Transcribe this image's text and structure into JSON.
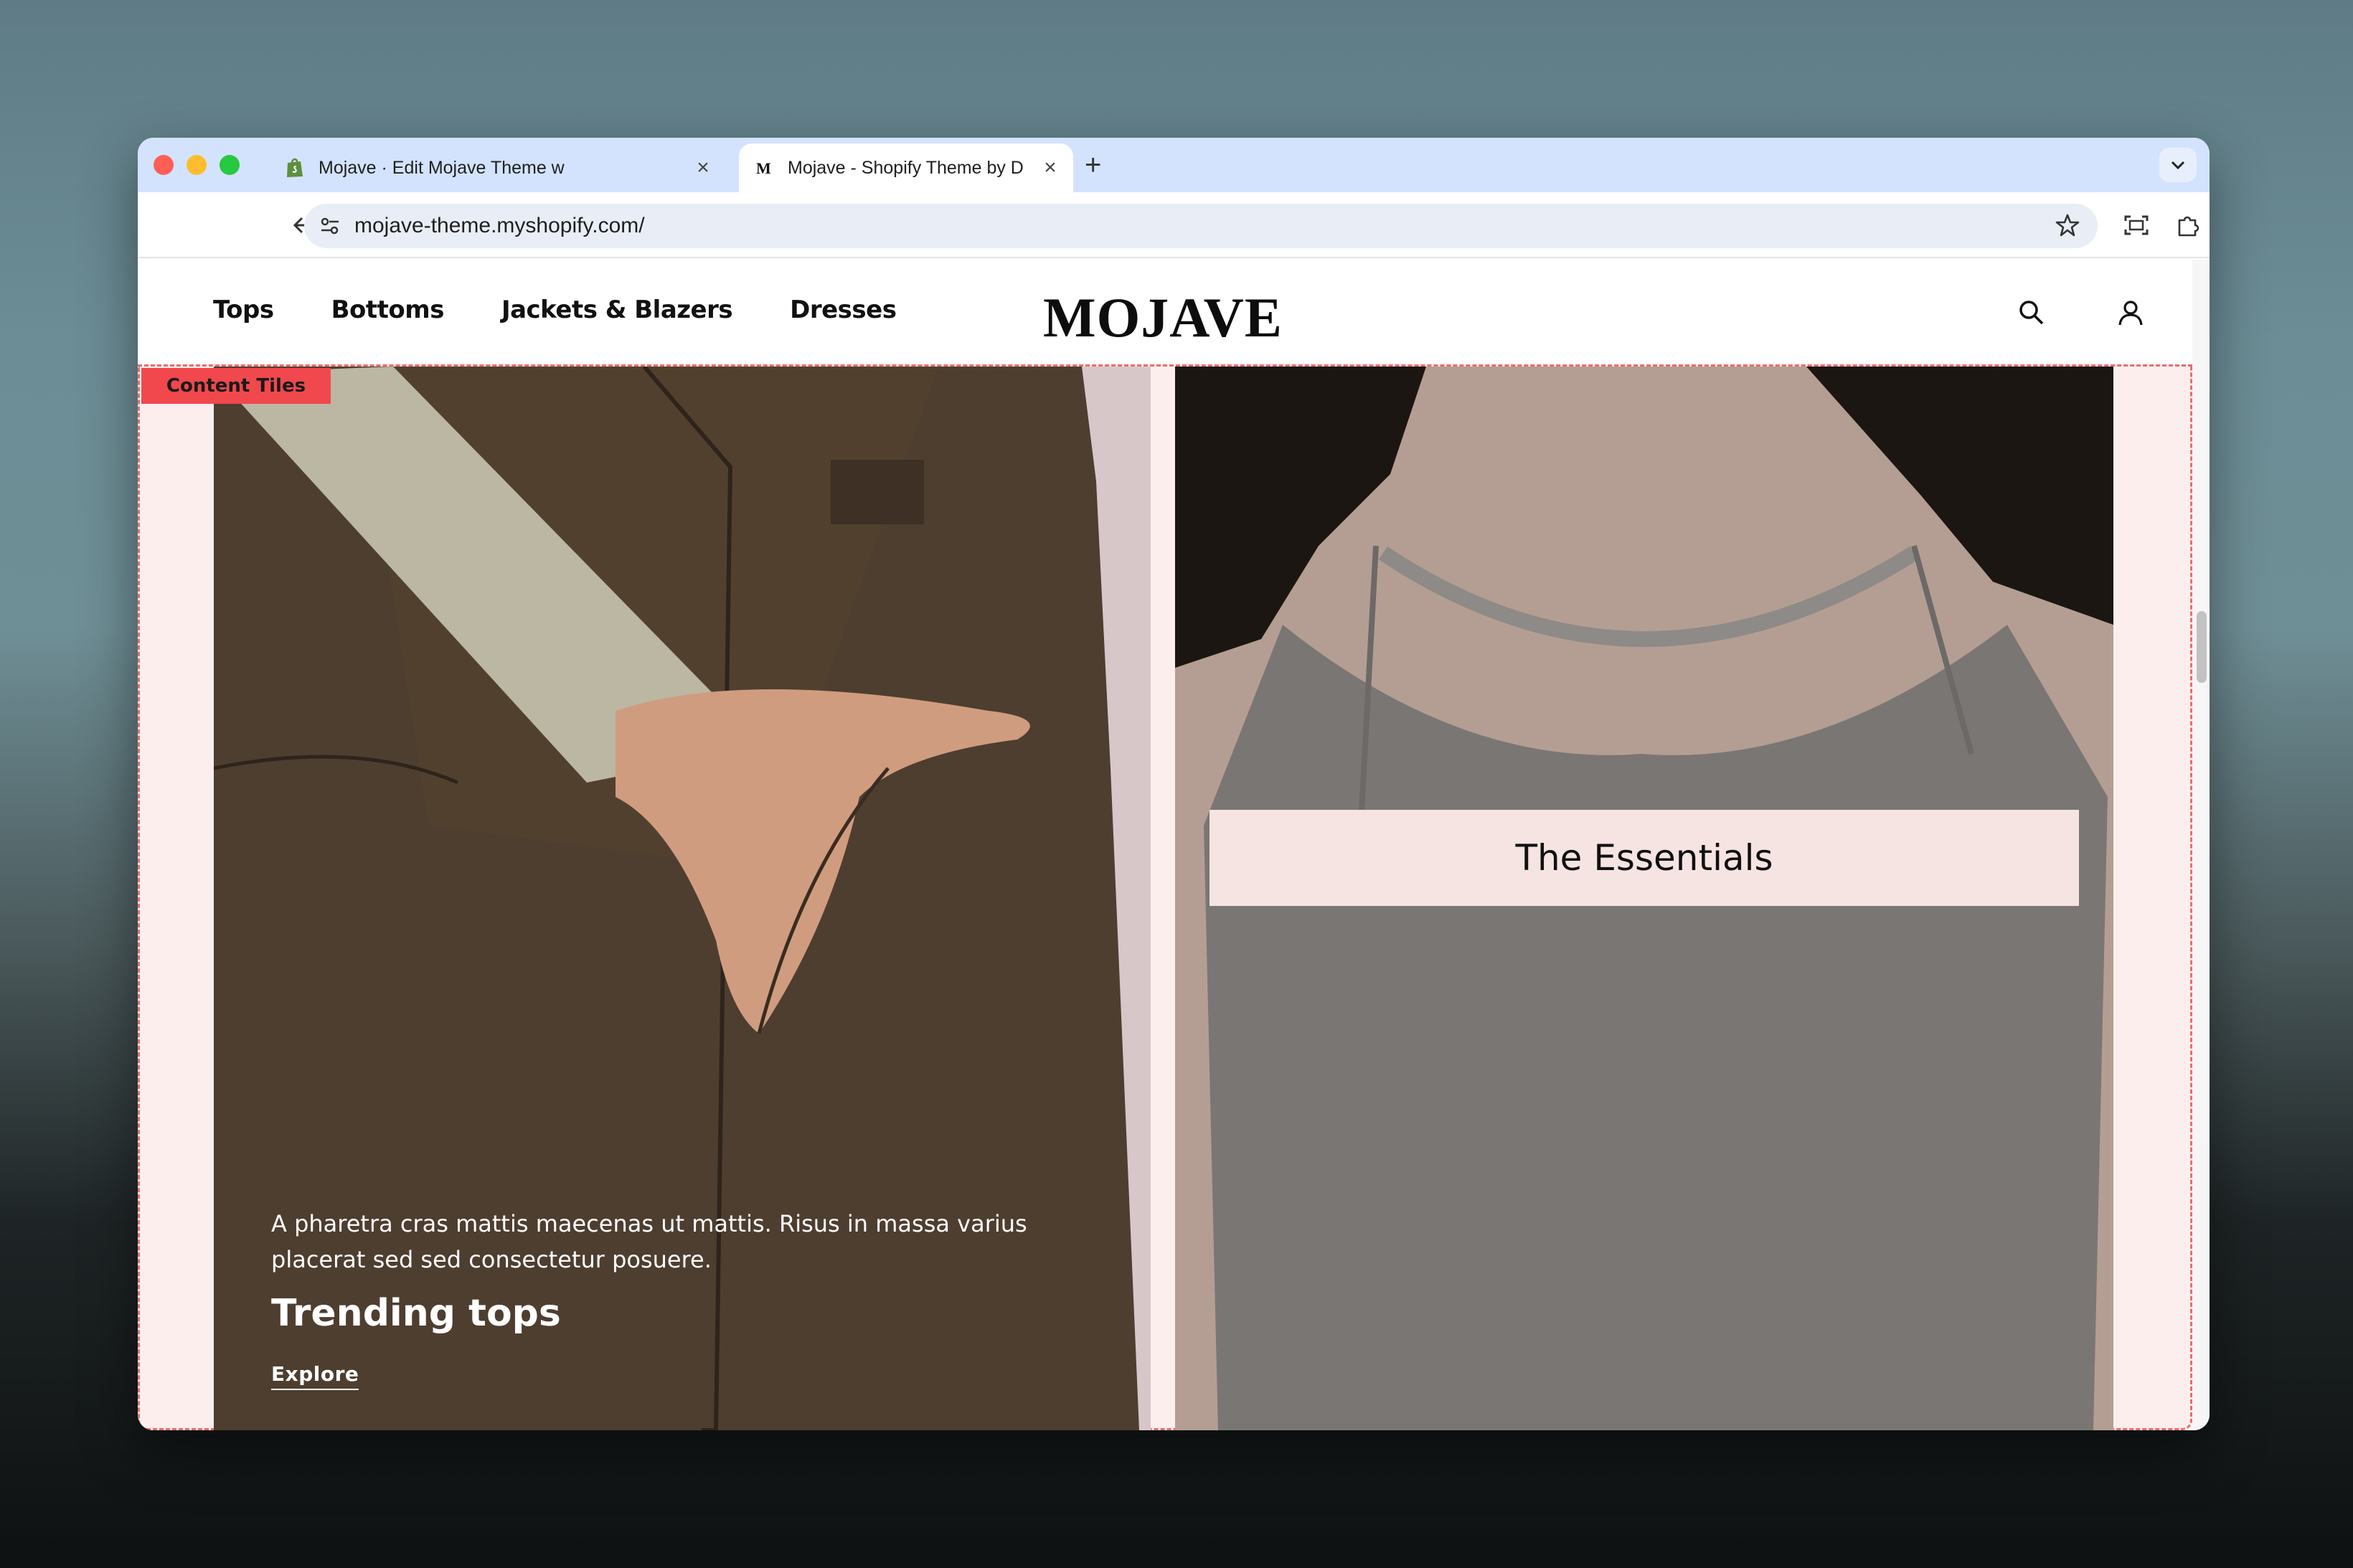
{
  "browser": {
    "tabs": [
      {
        "title": "Mojave · Edit Mojave Theme w",
        "active": false
      },
      {
        "title": "Mojave - Shopify Theme by D",
        "active": true
      }
    ],
    "url": "mojave-theme.myshopify.com/"
  },
  "site": {
    "logo": "MOJAVE",
    "nav": [
      "Tops",
      "Bottoms",
      "Jackets & Blazers",
      "Dresses"
    ]
  },
  "section": {
    "label": "Content Tiles",
    "tiles": [
      {
        "copy": "A pharetra cras mattis maecenas ut mattis. Risus in massa varius placerat sed sed consectetur posuere.",
        "heading": "Trending tops",
        "link": "Explore"
      },
      {
        "banner": "The Essentials"
      }
    ]
  },
  "colors": {
    "accent_label": "#f0484c",
    "section_bg": "#fdeeee",
    "tabstrip_bg": "#d3e3fd"
  }
}
